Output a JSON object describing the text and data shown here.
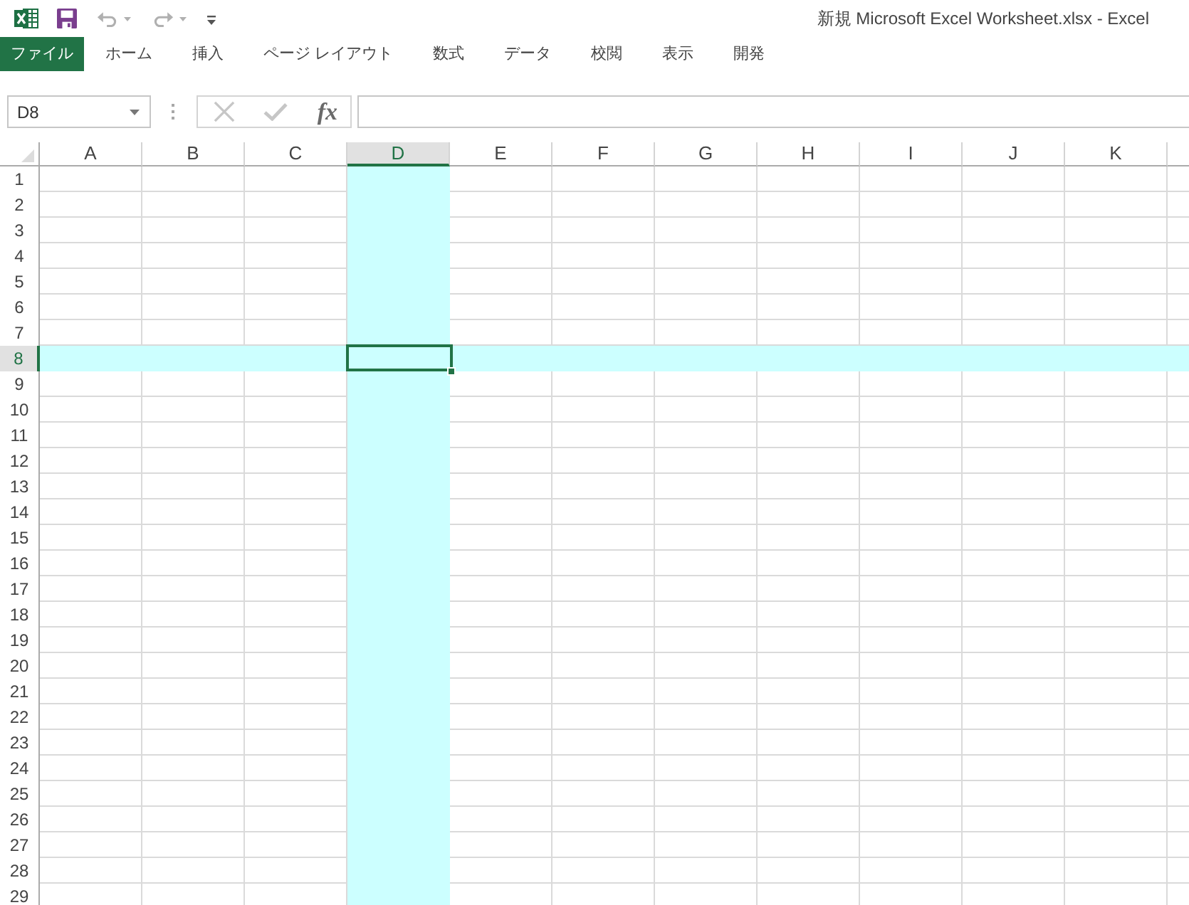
{
  "title_bar": {
    "quick_access": [
      {
        "kind": "save",
        "disabled": false
      },
      {
        "kind": "undo",
        "disabled": true
      },
      {
        "kind": "redo",
        "disabled": true
      },
      {
        "kind": "customize",
        "disabled": false
      }
    ],
    "title": "新規 Microsoft Excel Worksheet.xlsx - Excel"
  },
  "ribbon_tabs": [
    {
      "label": "ファイル",
      "kind": "file",
      "selected": false
    },
    {
      "label": "ホーム",
      "kind": "tab",
      "selected": false
    },
    {
      "label": "挿入",
      "kind": "tab",
      "selected": false
    },
    {
      "label": "ページ レイアウト",
      "kind": "tab",
      "selected": false
    },
    {
      "label": "数式",
      "kind": "tab",
      "selected": false
    },
    {
      "label": "データ",
      "kind": "tab",
      "selected": false
    },
    {
      "label": "校閲",
      "kind": "tab",
      "selected": false
    },
    {
      "label": "表示",
      "kind": "tab",
      "selected": false
    },
    {
      "label": "開発",
      "kind": "tab",
      "selected": false
    }
  ],
  "formula_bar": {
    "name_box": "D8",
    "buttons": [
      {
        "kind": "cancel",
        "disabled": true
      },
      {
        "kind": "enter",
        "disabled": true
      },
      {
        "kind": "function",
        "label": "fx",
        "disabled": false
      }
    ]
  },
  "sheet": {
    "columns": [
      {
        "label": "A",
        "selected": false
      },
      {
        "label": "B",
        "selected": false
      },
      {
        "label": "C",
        "selected": false
      },
      {
        "label": "D",
        "selected": true
      },
      {
        "label": "E",
        "selected": false
      },
      {
        "label": "F",
        "selected": false
      },
      {
        "label": "G",
        "selected": false
      },
      {
        "label": "H",
        "selected": false
      },
      {
        "label": "I",
        "selected": false
      },
      {
        "label": "J",
        "selected": false
      },
      {
        "label": "K",
        "selected": false
      }
    ],
    "rows": [
      {
        "label": "1",
        "selected": false
      },
      {
        "label": "2",
        "selected": false
      },
      {
        "label": "3",
        "selected": false
      },
      {
        "label": "4",
        "selected": false
      },
      {
        "label": "5",
        "selected": false
      },
      {
        "label": "6",
        "selected": false
      },
      {
        "label": "7",
        "selected": false
      },
      {
        "label": "8",
        "selected": true
      },
      {
        "label": "9",
        "selected": false
      },
      {
        "label": "10",
        "selected": false
      },
      {
        "label": "11",
        "selected": false
      },
      {
        "label": "12",
        "selected": false
      },
      {
        "label": "13",
        "selected": false
      },
      {
        "label": "14",
        "selected": false
      },
      {
        "label": "15",
        "selected": false
      },
      {
        "label": "16",
        "selected": false
      },
      {
        "label": "17",
        "selected": false
      },
      {
        "label": "18",
        "selected": false
      },
      {
        "label": "19",
        "selected": false
      },
      {
        "label": "20",
        "selected": false
      },
      {
        "label": "21",
        "selected": false
      },
      {
        "label": "22",
        "selected": false
      },
      {
        "label": "23",
        "selected": false
      },
      {
        "label": "24",
        "selected": false
      },
      {
        "label": "25",
        "selected": false
      },
      {
        "label": "26",
        "selected": false
      },
      {
        "label": "27",
        "selected": false
      },
      {
        "label": "28",
        "selected": false
      },
      {
        "label": "29",
        "selected": false
      }
    ]
  }
}
